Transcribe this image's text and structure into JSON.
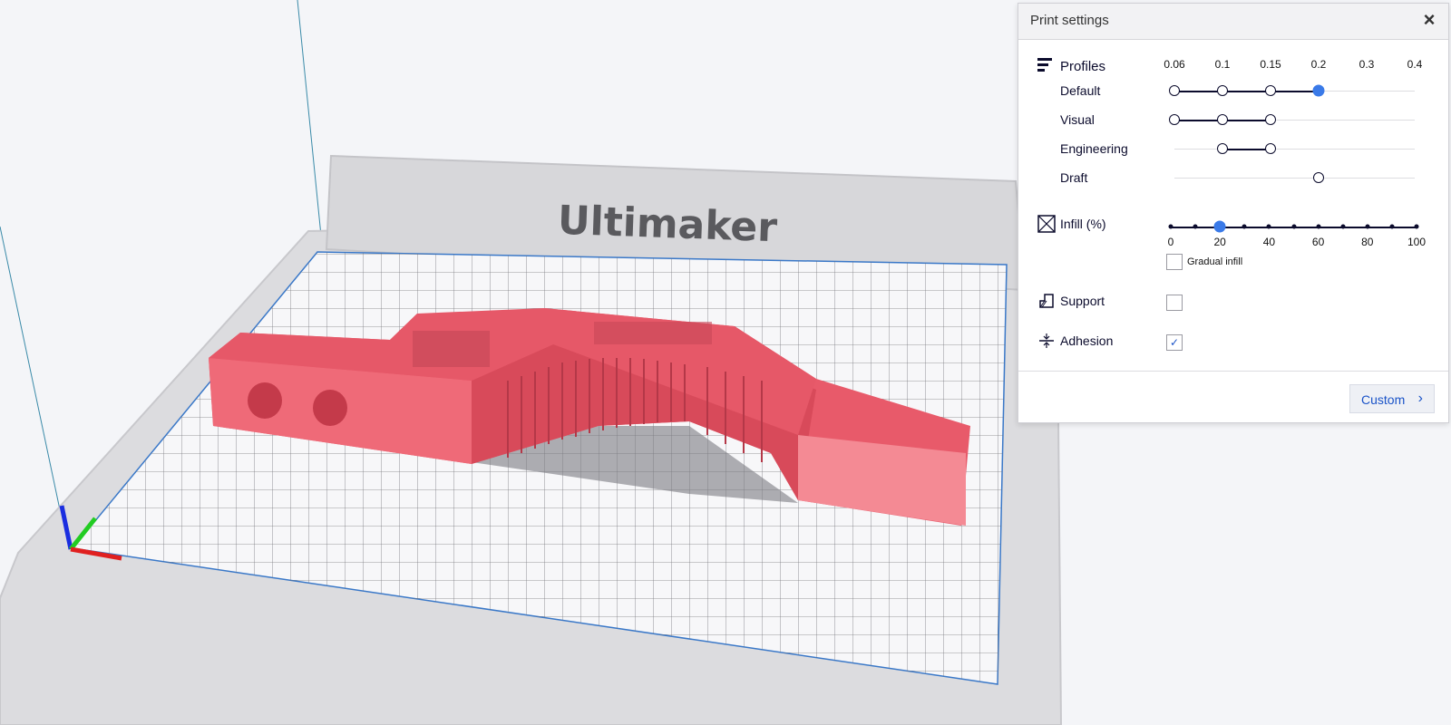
{
  "scene": {
    "brand_text": "Ultimaker",
    "model_color": "#e85a6a",
    "axis_colors": {
      "x": "#e02020",
      "y": "#22cc22",
      "z": "#1a2ee0"
    }
  },
  "panel": {
    "title": "Print settings",
    "close_icon": "×",
    "profiles": {
      "label": "Profiles",
      "icon": "profiles-icon",
      "layer_heights": [
        "0.06",
        "0.1",
        "0.15",
        "0.2",
        "0.3",
        "0.4"
      ],
      "rows": [
        {
          "label": "Default",
          "values": [
            "0.06",
            "0.1",
            "0.15",
            "0.2"
          ],
          "selected": "0.2"
        },
        {
          "label": "Visual",
          "values": [
            "0.06",
            "0.1",
            "0.15"
          ]
        },
        {
          "label": "Engineering",
          "values": [
            "0.1",
            "0.15"
          ]
        },
        {
          "label": "Draft",
          "values": [
            "0.2"
          ]
        }
      ]
    },
    "infill": {
      "label": "Infill (%)",
      "icon": "infill-icon",
      "ticks": [
        "0",
        "20",
        "40",
        "60",
        "80",
        "100"
      ],
      "value": 20,
      "gradual_label": "Gradual infill",
      "gradual_checked": false
    },
    "support": {
      "label": "Support",
      "icon": "support-icon",
      "checked": false
    },
    "adhesion": {
      "label": "Adhesion",
      "icon": "adhesion-icon",
      "checked": true,
      "check_mark": "✓"
    },
    "custom_button": {
      "label": "Custom",
      "chevron": "›"
    },
    "accent_color": "#3a7ae8",
    "dark_color": "#0b0b2c"
  }
}
